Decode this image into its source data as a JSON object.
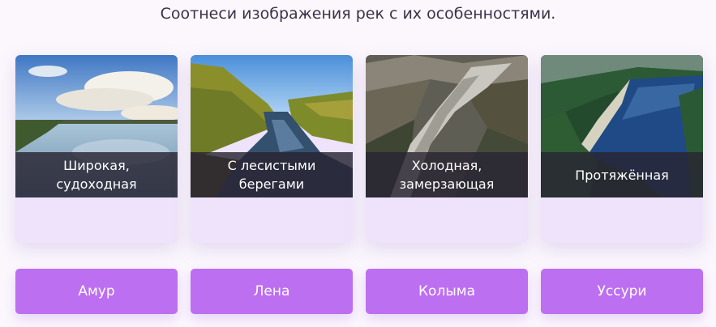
{
  "instruction": "Соотнеси изображения рек с их особенностями.",
  "cards": [
    {
      "caption_line1": "Широкая,",
      "caption_line2": "судоходная",
      "image_icon": "wide-river-photo"
    },
    {
      "caption_line1": "С лесистыми",
      "caption_line2": "берегами",
      "image_icon": "forest-river-photo"
    },
    {
      "caption_line1": "Холодная,",
      "caption_line2": "замерзающая",
      "image_icon": "mountain-river-photo"
    },
    {
      "caption_line1": "Протяжённая",
      "caption_line2": "",
      "image_icon": "long-river-photo"
    }
  ],
  "answers": [
    "Амур",
    "Лена",
    "Колыма",
    "Уссури"
  ],
  "colors": {
    "accent": "#bc6ff0",
    "drop_zone": "#efe3fb",
    "caption_bg": "#28243288",
    "background": "#fbf7fd"
  }
}
